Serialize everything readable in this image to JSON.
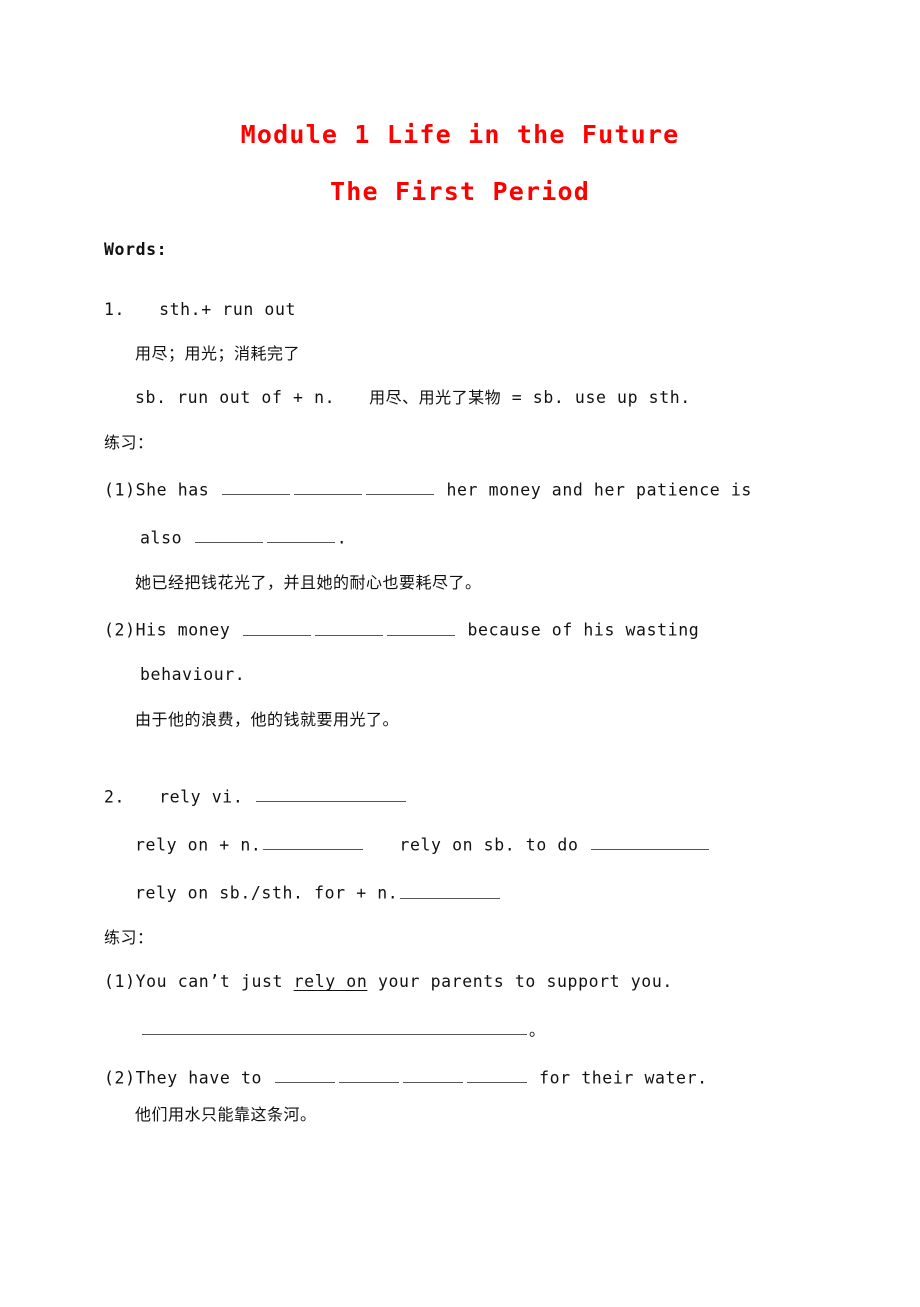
{
  "document": {
    "title_main": "Module 1 Life in the Future",
    "title_sub": "The First Period",
    "title_color": "#ff0000",
    "section_heading": "Words:"
  },
  "entries": [
    {
      "number": "1.",
      "headword": "sth.+ run out",
      "meaning_cn": "用尽；用光；消耗完了",
      "usage": "sb. run out of + n.",
      "usage_cn": "用尽、用光了某物",
      "usage_equals": "= sb. use up sth.",
      "practice_label": "练习：",
      "items": [
        {
          "marker": "(1)",
          "text_a": "She has",
          "text_b": "her money and her patience is",
          "text_c": "also",
          "text_d": ".",
          "translation_cn": "她已经把钱花光了，并且她的耐心也要耗尽了。"
        },
        {
          "marker": "(2)",
          "text_a": "His money",
          "text_b": "because of his wasting",
          "text_c": "behaviour.",
          "translation_cn": "由于他的浪费，他的钱就要用光了。"
        }
      ]
    },
    {
      "number": "2.",
      "headword": "rely vi.",
      "pattern_1": "rely on + n.",
      "pattern_2": "rely on sb. to do",
      "pattern_3": "rely on sb./sth. for + n.",
      "practice_label": "练习：",
      "items": [
        {
          "marker": "(1)",
          "text_a": "You can’t just",
          "underlined": "rely on",
          "text_b": "your parents to support you.",
          "answer_period": "。"
        },
        {
          "marker": "(2)",
          "text_a": "They have to",
          "text_b": "for their water.",
          "translation_cn": "他们用水只能靠这条河。"
        }
      ]
    }
  ]
}
